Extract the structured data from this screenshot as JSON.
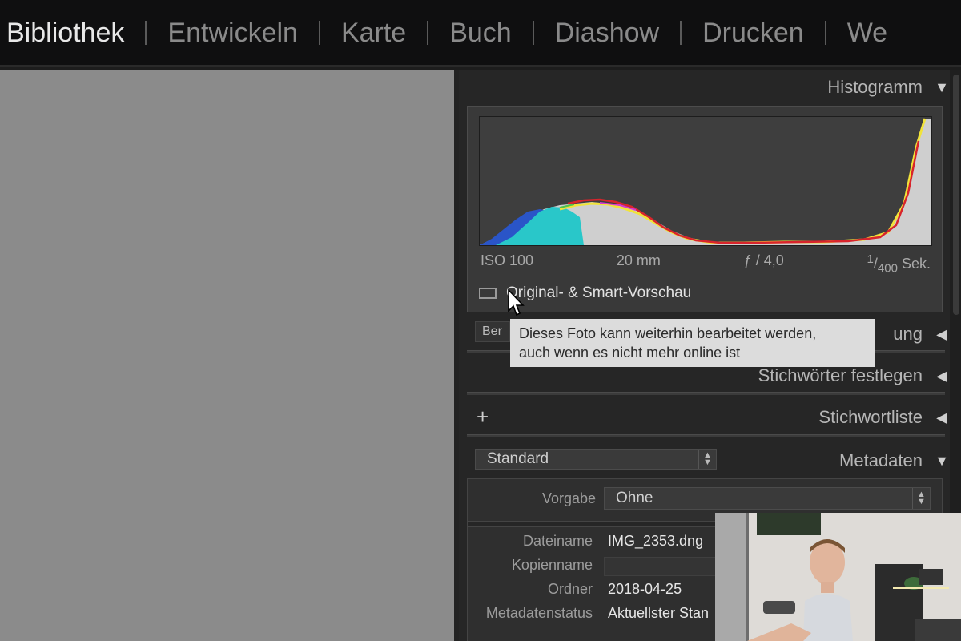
{
  "modules": {
    "items": [
      "Bibliothek",
      "Entwickeln",
      "Karte",
      "Buch",
      "Diashow",
      "Drucken",
      "We"
    ],
    "active_index": 0
  },
  "colors": {
    "accent_red": "#d8242c",
    "accent_yellow": "#f1e33a",
    "accent_cyan": "#29c7c9",
    "accent_blue": "#2a55c8"
  },
  "histogram": {
    "title": "Histogramm",
    "iso": "ISO 100",
    "focal": "20 mm",
    "aperture": "ƒ / 4,0",
    "shutter_num": "1",
    "shutter_den": "400",
    "shutter_unit": "Sek.",
    "preview_label": "Original- & Smart-Vorschau",
    "icon": "preview-frame-icon"
  },
  "tooltip": {
    "line1": "Dieses Foto kann weiterhin bearbeitet werden,",
    "line2": "auch wenn es nicht mehr online ist"
  },
  "quick_develop": {
    "stub_label": "Ber",
    "title_tail": "ung"
  },
  "keywording": {
    "title": "Stichwörter festlegen"
  },
  "keyword_list": {
    "title": "Stichwortliste",
    "plus": "+"
  },
  "metadata": {
    "preset_select": "Standard",
    "title": "Metadaten",
    "vorgabe_label": "Vorgabe",
    "vorgabe_value": "Ohne",
    "rows": [
      {
        "label": "Dateiname",
        "value": "IMG_2353.dng"
      },
      {
        "label": "Kopienname",
        "value": ""
      },
      {
        "label": "Ordner",
        "value": "2018-04-25"
      },
      {
        "label": "Metadatenstatus",
        "value": "Aktuellster Stan"
      }
    ]
  }
}
